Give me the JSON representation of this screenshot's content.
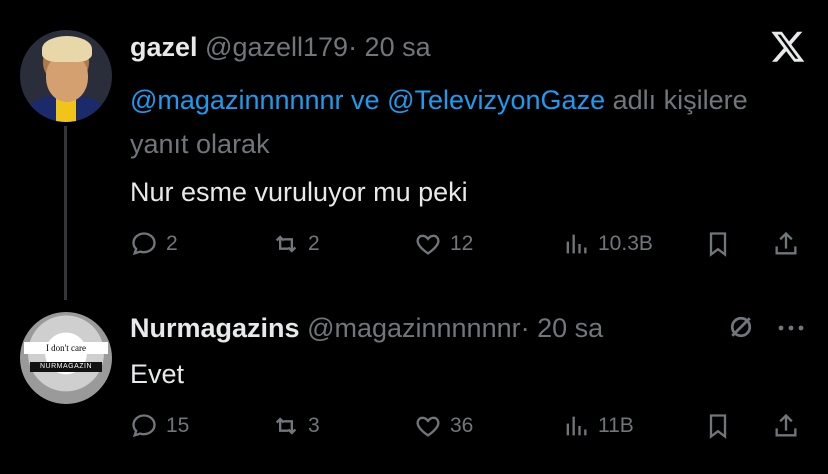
{
  "tweet1": {
    "display_name": "gazel",
    "handle": "@gazell179",
    "time": "· 20 sa",
    "reply_to": {
      "mention1": "@magazinnnnnnr",
      "joiner": " ve ",
      "mention2": "@TelevizyonGaze",
      "suffix": " adlı kişilere yanıt olarak"
    },
    "text": "Nur esme vuruluyor mu peki",
    "stats": {
      "replies": "2",
      "reposts": "2",
      "likes": "12",
      "views": "10.3B"
    }
  },
  "tweet2": {
    "display_name": "Nurmagazins",
    "handle": "@magazinnnnnnr",
    "time": "· 20 sa",
    "text": "Evet",
    "stats": {
      "replies": "15",
      "reposts": "3",
      "likes": "36",
      "views": "11B"
    }
  },
  "avatar2": {
    "line1": "I don't care",
    "line2": "NURMAGAZIN"
  },
  "icons": [
    "x-logo-icon",
    "reply-icon",
    "repost-icon",
    "like-icon",
    "views-icon",
    "bookmark-icon",
    "share-icon",
    "muted-icon",
    "more-icon"
  ],
  "colors": {
    "background": "#000000",
    "text": "#e7e9ea",
    "muted": "#71767b",
    "link": "#1d9bf0"
  }
}
